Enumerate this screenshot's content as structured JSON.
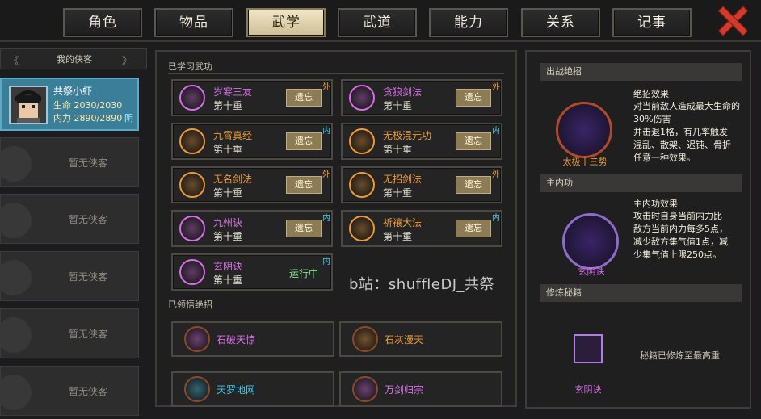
{
  "tabs": [
    "角色",
    "物品",
    "武学",
    "武道",
    "能力",
    "关系",
    "记事"
  ],
  "active_tab": 2,
  "left": {
    "header": "我的侠客",
    "hero": {
      "name": "共祭小虾",
      "hp": "生命 2030/2030",
      "mp": "内力 2890/2890",
      "tag": "阴"
    },
    "empty_slots": [
      "暂无侠客",
      "暂无侠客",
      "暂无侠客",
      "暂无侠客",
      "暂无侠客"
    ]
  },
  "middle": {
    "learned_header": "已学习武功",
    "skills": [
      {
        "name": "岁寒三友",
        "level": "第十重",
        "action": "遗忘",
        "type": "外",
        "color": "#d86ee8"
      },
      {
        "name": "贪狼剑法",
        "level": "第十重",
        "action": "遗忘",
        "type": "外",
        "color": "#d86ee8"
      },
      {
        "name": "九霄真经",
        "level": "第十重",
        "action": "遗忘",
        "type": "内",
        "color": "#ee9a38"
      },
      {
        "name": "无极混元功",
        "level": "第十重",
        "action": "遗忘",
        "type": "内",
        "color": "#ee9a38"
      },
      {
        "name": "无名剑法",
        "level": "第十重",
        "action": "遗忘",
        "type": "外",
        "color": "#ee9a38"
      },
      {
        "name": "无招剑法",
        "level": "第十重",
        "action": "遗忘",
        "type": "外",
        "color": "#ee9a38"
      },
      {
        "name": "九州诀",
        "level": "第十重",
        "action": "遗忘",
        "type": "内",
        "color": "#d86ee8"
      },
      {
        "name": "祈禳大法",
        "level": "第十重",
        "action": "遗忘",
        "type": "内",
        "color": "#ee9a38"
      },
      {
        "name": "玄阴诀",
        "level": "第十重",
        "action": "运行中",
        "type": "内",
        "color": "#d86ee8"
      }
    ],
    "ult_header": "已领悟绝招",
    "ults": [
      {
        "name": "石破天惊",
        "color": "#d86ee8"
      },
      {
        "name": "石灰漫天",
        "color": "#ee9a38"
      },
      {
        "name": "天罗地网",
        "color": "#48c8e8"
      },
      {
        "name": "万剑归宗",
        "color": "#d86ee8"
      }
    ],
    "watermark": "b站：shuffleDJ_共祭"
  },
  "right": {
    "ult_section": "出战绝招",
    "ult_effect_title": "绝招效果",
    "ult_effect": [
      "对当前敌人造成最大生命的",
      "30%伤害",
      "并击退1格，有几率触发",
      "混乱、散架、迟钝、骨折",
      "任意一种效果。"
    ],
    "ult_name": "太极十三势",
    "inner_section": "主内功",
    "inner_effect_title": "主内功效果",
    "inner_effect": [
      "攻击时自身当前内力比",
      "敌方当前内力每多5点，",
      "减少敌方集气值1点，减",
      "少集气值上限250点。"
    ],
    "inner_name": "玄阴诀",
    "book_section": "修炼秘籍",
    "book_text": "秘籍已修炼至最高重",
    "book_name": "玄阴诀"
  }
}
